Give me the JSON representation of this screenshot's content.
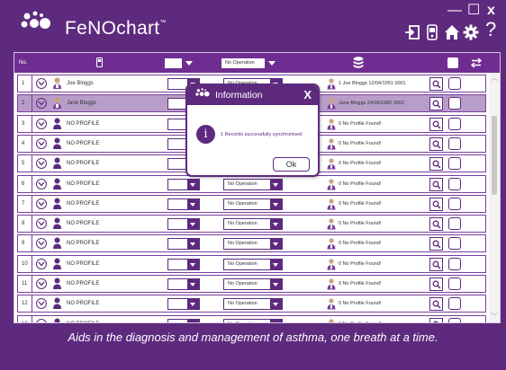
{
  "app": {
    "name": "FeNOchart",
    "trademark": "™"
  },
  "window_controls": {
    "minimize": "—",
    "maximize": "☐",
    "close": "x"
  },
  "header_icons": [
    "logout-icon",
    "device-icon",
    "home-icon",
    "settings-icon",
    "help-icon"
  ],
  "help_label": "?",
  "table": {
    "col_no": "No.",
    "filter_operation": "No Operation",
    "rows": [
      {
        "num": "1",
        "name": "Joe Bloggs",
        "type": "named",
        "patient": "1 Joe Bloggs 12/04/1951 0001",
        "operation": "No Operation"
      },
      {
        "num": "2",
        "name": "Jane Bloggs",
        "type": "named",
        "patient": "Jane Bloggs 24/06/1982 0002",
        "operation": "No Operation"
      },
      {
        "num": "3",
        "name": "NO PROFILE",
        "type": "none",
        "patient": "0 No Profile Found!",
        "operation": "No Operation"
      },
      {
        "num": "4",
        "name": "NO PROFILE",
        "type": "none",
        "patient": "0 No Profile Found!",
        "operation": "No Operation"
      },
      {
        "num": "5",
        "name": "NO PROFILE",
        "type": "none",
        "patient": "0 No Profile Found!",
        "operation": "No Operation"
      },
      {
        "num": "6",
        "name": "NO PROFILE",
        "type": "none",
        "patient": "0 No Profile Found!",
        "operation": "No Operation"
      },
      {
        "num": "7",
        "name": "NO PROFILE",
        "type": "none",
        "patient": "0 No Profile Found!",
        "operation": "No Operation"
      },
      {
        "num": "8",
        "name": "NO PROFILE",
        "type": "none",
        "patient": "0 No Profile Found!",
        "operation": "No Operation"
      },
      {
        "num": "9",
        "name": "NO PROFILE",
        "type": "none",
        "patient": "0 No Profile Found!",
        "operation": "No Operation"
      },
      {
        "num": "10",
        "name": "NO PROFILE",
        "type": "none",
        "patient": "0 No Profile Found!",
        "operation": "No Operation"
      },
      {
        "num": "11",
        "name": "NO PROFILE",
        "type": "none",
        "patient": "0 No Profile Found!",
        "operation": "No Operation"
      },
      {
        "num": "12",
        "name": "NO PROFILE",
        "type": "none",
        "patient": "0 No Profile Found!",
        "operation": "No Operation"
      },
      {
        "num": "13",
        "name": "NO PROFILE",
        "type": "none",
        "patient": "0 No Profile Found!",
        "operation": "No Operation"
      }
    ],
    "selected_row": "2"
  },
  "dialog": {
    "title": "Information",
    "close_label": "X",
    "info_glyph": "i",
    "message": "1 Records successfully synchronised",
    "ok_label": "Ok"
  },
  "tagline": "Aids in the diagnosis and management of asthma, one breath at a time.",
  "colors": {
    "brand": "#5d2a7e",
    "header_bar": "#6f2d91",
    "selected_row": "#b89dc9"
  }
}
